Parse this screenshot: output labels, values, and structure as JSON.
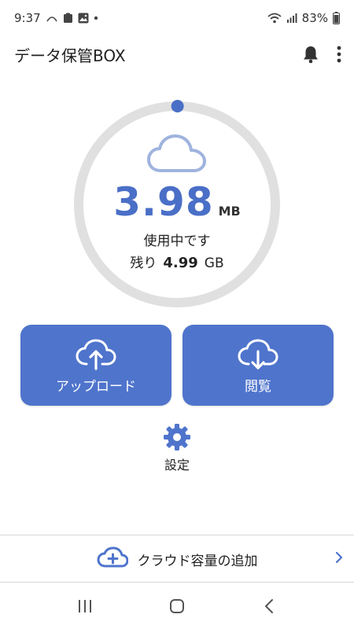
{
  "status_bar": {
    "time": "9:37",
    "battery": "83%",
    "icons": [
      "notification-arc-icon",
      "clipboard-icon",
      "gallery-icon",
      "dot-icon",
      "wifi-icon",
      "signal-icon",
      "battery-icon"
    ]
  },
  "app_bar": {
    "title": "データ保管BOX",
    "icons": [
      "bell-icon",
      "more-vert-icon"
    ]
  },
  "usage": {
    "used_value": "3.98",
    "used_unit": "MB",
    "in_use_label": "使用中です",
    "remaining_label": "残り",
    "remaining_value": "4.99",
    "remaining_unit": "GB",
    "used_fraction": 0.0008,
    "colors": {
      "accent": "#4a6fc7",
      "ring_track": "#e0e0e0",
      "cloud": "#9fb3de"
    }
  },
  "actions": {
    "upload_label": "アップロード",
    "browse_label": "閲覧",
    "settings_label": "設定",
    "button_color": "#4f74cc"
  },
  "footer": {
    "add_cloud_label": "クラウド容量の追加"
  },
  "nav": {
    "icons": [
      "recent-apps-icon",
      "home-icon",
      "back-icon"
    ]
  }
}
